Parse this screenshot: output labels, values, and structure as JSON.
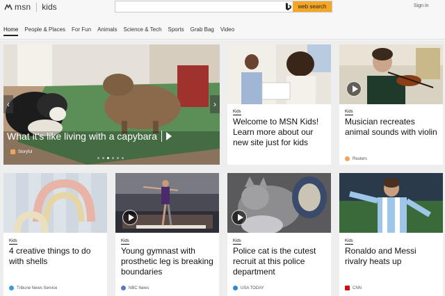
{
  "header": {
    "logo_text": "msn",
    "logo_section": "kids",
    "search": {
      "value": "",
      "button_label": "web search"
    },
    "signin_label": "Sign in"
  },
  "nav": {
    "items": [
      {
        "label": "Home",
        "active": true
      },
      {
        "label": "People & Places"
      },
      {
        "label": "For Fun"
      },
      {
        "label": "Animals"
      },
      {
        "label": "Science & Tech"
      },
      {
        "label": "Sports"
      },
      {
        "label": "Grab Bag"
      },
      {
        "label": "Video"
      }
    ]
  },
  "hero": {
    "title": "What it's like living with a capybara",
    "source": "Storyful",
    "arrow_left": "‹",
    "arrow_right": "›",
    "slide_count": 6,
    "active_slide": 2
  },
  "cards": [
    {
      "badge": "Kids",
      "title": "Welcome to MSN Kids! Learn more about our new site just for kids",
      "source": ""
    },
    {
      "badge": "Kids",
      "title": "Musician recreates animal sounds with violin",
      "source": "Reuters",
      "source_color": "#f2a35e"
    },
    {
      "badge": "Kids",
      "title": "4 creative things to do with shells",
      "source": "Tribune News Service",
      "source_color": "#3a9bd9"
    },
    {
      "badge": "Kids",
      "title": "Young gymnast with prosthetic leg is breaking boundaries",
      "source": "NBC News",
      "source_color": "#5a78c8"
    },
    {
      "badge": "Kids",
      "title": "Police cat is the cutest recruit at this police department",
      "source": "USA TODAY",
      "source_color": "#2a8ad8"
    },
    {
      "badge": "Kids",
      "title": "Ronaldo and Messi rivalry heats up",
      "source": "CNN",
      "source_color": "#cc1111"
    }
  ],
  "colors": {
    "accent": "#f5a623",
    "background": "#eeeeee"
  }
}
